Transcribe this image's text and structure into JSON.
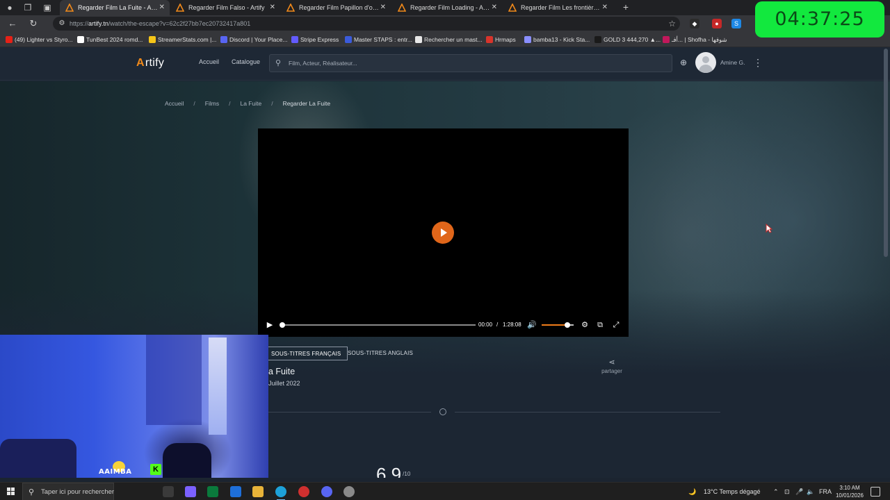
{
  "browser": {
    "tabs": [
      {
        "title": "Regarder Film La Fuite - Artify",
        "active": true
      },
      {
        "title": "Regarder Film Falso - Artify",
        "active": false
      },
      {
        "title": "Regarder Film Papillon d'or - Artify",
        "active": false
      },
      {
        "title": "Regarder Film Loading - Artify",
        "active": false
      },
      {
        "title": "Regarder Film Les frontières du ciel - Artify",
        "active": false
      }
    ],
    "url_prefix": "https://",
    "url_domain": "artify.tn",
    "url_path": "/watch/the-escape?v=62c2f27bb7ec20732417a801",
    "bookmarks": [
      {
        "label": "(49) Lighter vs Styro...",
        "color": "#e62117"
      },
      {
        "label": "TunBest 2024 romd...",
        "color": "#ffffff"
      },
      {
        "label": "StreamerStats.com |...",
        "color": "#f5c518"
      },
      {
        "label": "Discord | Your Place...",
        "color": "#5865f2"
      },
      {
        "label": "Stripe Express",
        "color": "#635bff"
      },
      {
        "label": "Master STAPS : entr...",
        "color": "#3b5bdb"
      },
      {
        "label": "Rechercher un mast...",
        "color": "#e8e8e8"
      },
      {
        "label": "Hrmaps",
        "color": "#d9342b"
      },
      {
        "label": "bamba13 - Kick Sta...",
        "color": "#8a8fff"
      },
      {
        "label": "GOLD 3 444,270 ▲...",
        "color": "#1a1a1a"
      },
      {
        "label": "أفـ... | Shofha - شوفها",
        "color": "#c2185b"
      }
    ]
  },
  "overlay_clock": "04:37:25",
  "site": {
    "logo_mark": "A",
    "logo_text": "rtify",
    "nav": [
      "Accueil",
      "Catalogue"
    ],
    "search_placeholder": "Film, Acteur, Réalisateur...",
    "user_name": "Amine G."
  },
  "breadcrumb": [
    "Accueil",
    "Films",
    "La Fuite",
    "Regarder La Fuite"
  ],
  "player": {
    "current_time": "00:00",
    "separator": "/",
    "duration": "1:28:08",
    "progress": 0,
    "volume": 0.8
  },
  "subtitles": [
    {
      "label": "SOUS-TITRES FRANÇAIS",
      "selected": true
    },
    {
      "label": "SOUS-TITRES ANGLAIS",
      "selected": false
    }
  ],
  "film": {
    "title": "a Fuite",
    "date": "Juillet 2022",
    "share_label": "partager",
    "rating": "6,9"
  },
  "taskbar": {
    "search_placeholder": "Taper ici pour rechercher",
    "weather": "13°C  Temps dégagé",
    "lang": "FRA",
    "time": "3:10 AM",
    "date": "10/01/2026"
  },
  "webcam": {
    "sticker_text": "AAIMBA"
  },
  "colors": {
    "accent": "#e0661a",
    "clock_bg": "#12e83e"
  }
}
